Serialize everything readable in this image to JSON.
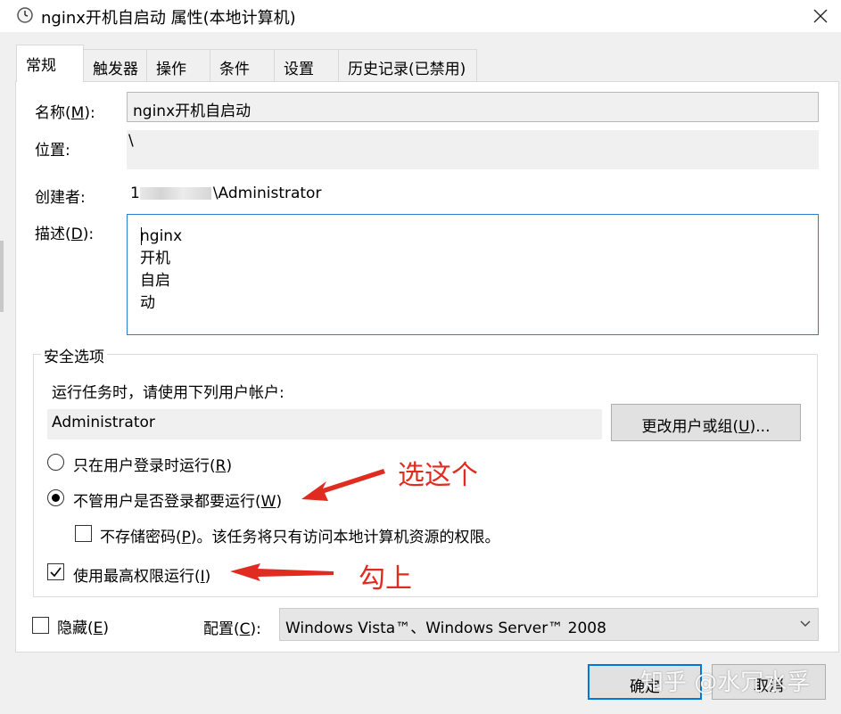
{
  "window": {
    "title": "nginx开机自启动 属性(本地计算机)",
    "icon": "clock-icon"
  },
  "tabs": [
    {
      "label": "常规",
      "active": true
    },
    {
      "label": "触发器"
    },
    {
      "label": "操作"
    },
    {
      "label": "条件"
    },
    {
      "label": "设置"
    },
    {
      "label": "历史记录(已禁用)"
    }
  ],
  "general": {
    "name_label_pre": "名称(",
    "name_label_key": "M",
    "name_label_post": "):",
    "name_value": "nginx开机自启动",
    "location_label": "位置:",
    "location_value": "\\",
    "author_label": "创建者:",
    "author_value_prefix": "1",
    "author_value": "\\Administrator",
    "description_label_pre": "描述(",
    "description_label_key": "D",
    "description_label_post": "):",
    "description_value": "nginx开机自启动"
  },
  "security": {
    "group_title": "安全选项",
    "run_as_prompt": "运行任务时，请使用下列用户帐户:",
    "account_value": "Administrator",
    "change_user_pre": "更改用户或组(",
    "change_user_key": "U",
    "change_user_post": ")...",
    "radio_logged_on_pre": "只在用户登录时运行(",
    "radio_logged_on_key": "R",
    "radio_logged_on_post": ")",
    "radio_whether_pre": "不管用户是否登录都要运行(",
    "radio_whether_key": "W",
    "radio_whether_post": ")",
    "selected_option": "whether_logged_on",
    "no_store_pwd_pre": "不存储密码(",
    "no_store_pwd_key": "P",
    "no_store_pwd_post": ")。该任务将只有访问本地计算机资源的权限。",
    "no_store_pwd_checked": false,
    "highest_priv_pre": "使用最高权限运行(",
    "highest_priv_key": "I",
    "highest_priv_post": ")",
    "highest_priv_checked": true
  },
  "bottom": {
    "hidden_label_pre": "隐藏(",
    "hidden_label_key": "E",
    "hidden_label_post": ")",
    "hidden_checked": false,
    "configure_label_pre": "配置(",
    "configure_label_key": "C",
    "configure_label_post": "):",
    "configure_value": "Windows Vista™、Windows Server™ 2008"
  },
  "buttons": {
    "ok": "确定",
    "cancel": "取消"
  },
  "annotations": {
    "select_this": "选这个",
    "check_on": "勾上",
    "color": "#e02b20"
  },
  "watermark": "知乎 @水冗水孚"
}
